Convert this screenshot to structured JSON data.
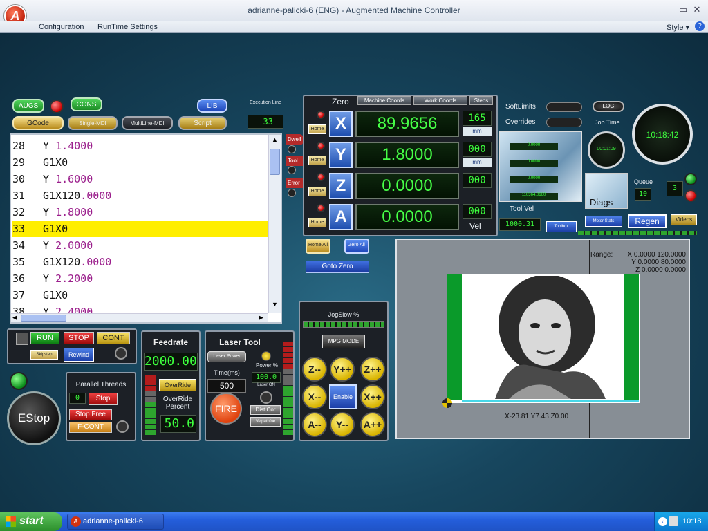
{
  "window": {
    "title": "adrianne-palicki-6 (ENG) - Augmented Machine Controller",
    "logo_letter": "A",
    "style_label": "Style"
  },
  "menu": [
    "Configuration",
    "RunTime Settings"
  ],
  "top_buttons": {
    "augs": "AUGS",
    "cons": "CONS",
    "lib": "LIB",
    "gcode": "GCode",
    "single_mdi": "Single-MDI",
    "multiline_mdi": "MultiLine-MDI",
    "script": "Script"
  },
  "execution": {
    "label": "Execution Line",
    "value": "33"
  },
  "code_lines": [
    {
      "num": "28",
      "code": "Y ",
      "val": "1.4000"
    },
    {
      "num": "29",
      "code": "G1X0",
      "val": ""
    },
    {
      "num": "30",
      "code": "Y ",
      "val": "1.6000"
    },
    {
      "num": "31",
      "code": "G1X120",
      "val": ".0000"
    },
    {
      "num": "32",
      "code": "Y ",
      "val": "1.8000"
    },
    {
      "num": "33",
      "code": "G1X0",
      "val": ""
    },
    {
      "num": "34",
      "code": "Y ",
      "val": "2.0000"
    },
    {
      "num": "35",
      "code": "G1X120",
      "val": ".0000"
    },
    {
      "num": "36",
      "code": "Y ",
      "val": "2.2000"
    },
    {
      "num": "37",
      "code": "G1X0",
      "val": ""
    },
    {
      "num": "38",
      "code": "Y ",
      "val": "2.4000"
    }
  ],
  "side_tabs": [
    "Dwell",
    "Tool",
    "Error"
  ],
  "dro": {
    "zero_label": "Zero",
    "tabs": [
      "Machine Coords",
      "Work Coords",
      "Steps"
    ],
    "home_label": "Home",
    "axes": [
      {
        "name": "X",
        "value": "89.9656"
      },
      {
        "name": "Y",
        "value": "1.8000"
      },
      {
        "name": "Z",
        "value": "0.0000"
      },
      {
        "name": "A",
        "value": "0.0000"
      }
    ],
    "small_readouts": [
      "165",
      "000",
      "000",
      "000"
    ],
    "unit": "mm",
    "vel_label": "Vel",
    "home_all": "Home All",
    "zero_all": "Zero All",
    "goto_zero": "Goto Zero"
  },
  "status": {
    "soft_limits": "SoftLimits",
    "overrides": "Overrides",
    "log": "LOG",
    "job_time_label": "Job Time",
    "job_time": "00:01:09",
    "clock": "10:18:42",
    "queue_label": "Queue",
    "queue_value": "10",
    "queue_side": "3",
    "diags": "Diags",
    "tool_vel_label": "Tool Vel",
    "tool_vel": "1000.31",
    "toolbox": "Toolbox",
    "motor_stats": "Motor Stats",
    "regen": "Regen",
    "videos": "Videos",
    "small_value": "110364.0660"
  },
  "toolpath": {
    "range_label": "Range:",
    "range_lines": [
      "X 0.0000  120.0000",
      "Y 0.0000  80.0000",
      "Z 0.0000  0.0000"
    ],
    "position": "X-23.81 Y7.43 Z0.00"
  },
  "run_panel": {
    "run": "RUN",
    "stop": "STOP",
    "cont": "CONT",
    "rewind": "Rewind",
    "skip": "Skipstep"
  },
  "estop": "EStop",
  "parallel": {
    "title": "Parallel Threads",
    "count": "0",
    "stop": "Stop",
    "stop_free": "Stop Free",
    "f_cont": "F-CONT"
  },
  "feed": {
    "title": "Feedrate",
    "value": "2000.00",
    "override": "OverRide",
    "override_pct_label": "OverRide Percent",
    "override_pct": "50.0"
  },
  "laser": {
    "title": "Laser Tool",
    "laser_power": "Laser Power",
    "power_pct": "Power %",
    "power_value": "100.0",
    "laser_on": "Laser ON",
    "time_label": "Time(ms)",
    "time_value": "500",
    "fire": "FIRE",
    "dist_cor": "Dist Cor",
    "vel_follow": "Velpathfoe"
  },
  "jog": {
    "title": "JogSlow %",
    "mpg": "MPG MODE",
    "enable": "Enable",
    "buttons": [
      "Z--",
      "Y++",
      "Z++",
      "X--",
      "X++",
      "A--",
      "Y--",
      "A++"
    ]
  },
  "taskbar": {
    "start": "start",
    "task": "adrianne-palicki-6 (EN...",
    "time": "10:18"
  },
  "colors": {
    "dro_text": "#46ff46",
    "highlight": "#ffee00",
    "value_text": "#9b1f8c"
  }
}
